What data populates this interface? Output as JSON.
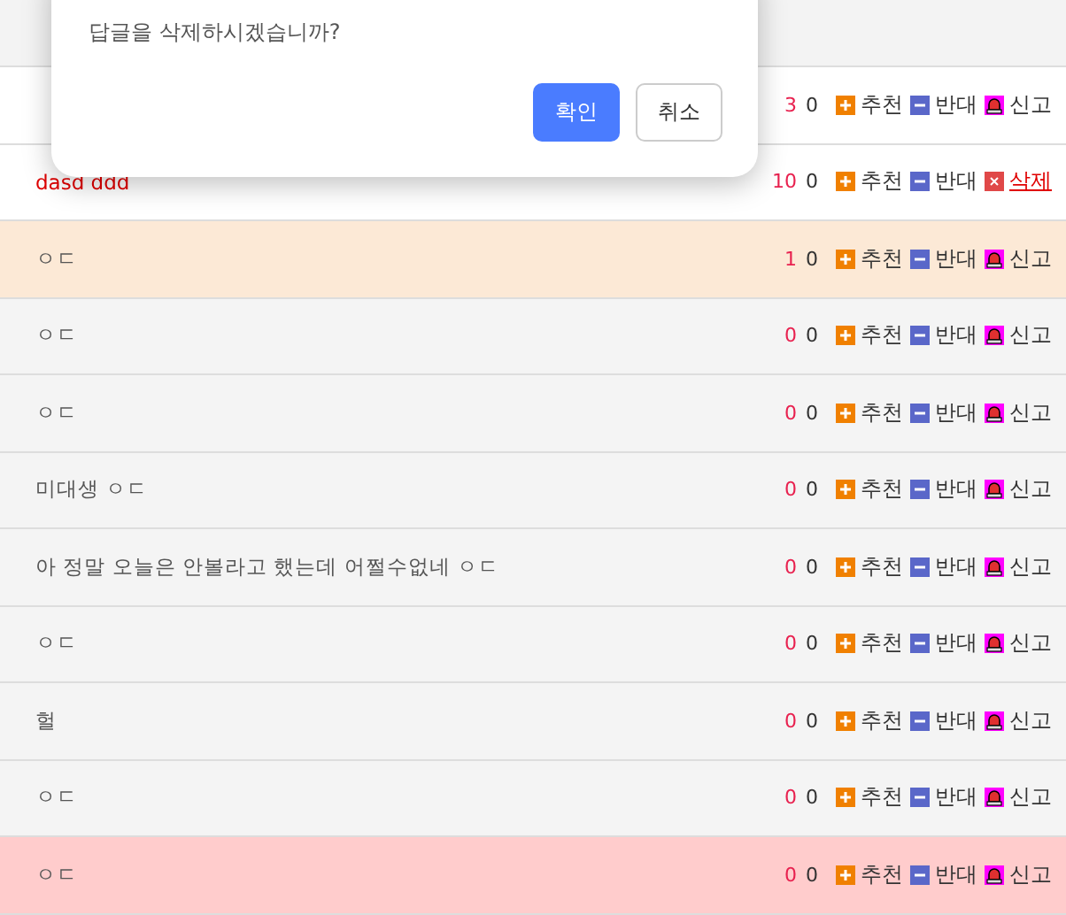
{
  "rows": [
    {
      "color": "#ffffff",
      "up": "3",
      "down": "0",
      "actions": [
        {
          "kind": "up",
          "label": "추천"
        },
        {
          "kind": "down",
          "label": "반대"
        },
        {
          "kind": "report",
          "label": "신고"
        }
      ]
    },
    {
      "text": "dasd ddd",
      "highlighted": true,
      "color": "#ffffff",
      "up": "10",
      "down": "0",
      "actions": [
        {
          "kind": "up",
          "label": "추천"
        },
        {
          "kind": "down",
          "label": "반대"
        },
        {
          "kind": "delete",
          "label": "삭제"
        }
      ]
    },
    {
      "text": "ㅇㄷ",
      "highlighted": false,
      "color": "#fce9d6",
      "up": "1",
      "down": "0",
      "actions": [
        {
          "kind": "up",
          "label": "추천"
        },
        {
          "kind": "down",
          "label": "반대"
        },
        {
          "kind": "report",
          "label": "신고"
        }
      ]
    },
    {
      "text": "ㅇㄷ",
      "highlighted": false,
      "color": "#f4f4f4",
      "up": "0",
      "down": "0",
      "actions": [
        {
          "kind": "up",
          "label": "추천"
        },
        {
          "kind": "down",
          "label": "반대"
        },
        {
          "kind": "report",
          "label": "신고"
        }
      ]
    },
    {
      "text": "ㅇㄷ",
      "highlighted": false,
      "color": "#f4f4f4",
      "up": "0",
      "down": "0",
      "actions": [
        {
          "kind": "up",
          "label": "추천"
        },
        {
          "kind": "down",
          "label": "반대"
        },
        {
          "kind": "report",
          "label": "신고"
        }
      ]
    },
    {
      "text": "미대생 ㅇㄷ",
      "highlighted": false,
      "color": "#f4f4f4",
      "up": "0",
      "down": "0",
      "actions": [
        {
          "kind": "up",
          "label": "추천"
        },
        {
          "kind": "down",
          "label": "반대"
        },
        {
          "kind": "report",
          "label": "신고"
        }
      ]
    },
    {
      "text": "아 정말 오늘은 안볼라고 했는데 어쩔수없네 ㅇㄷ",
      "highlighted": false,
      "color": "#f4f4f4",
      "up": "0",
      "down": "0",
      "actions": [
        {
          "kind": "up",
          "label": "추천"
        },
        {
          "kind": "down",
          "label": "반대"
        },
        {
          "kind": "report",
          "label": "신고"
        }
      ]
    },
    {
      "text": "ㅇㄷ",
      "highlighted": false,
      "color": "#f4f4f4",
      "up": "0",
      "down": "0",
      "actions": [
        {
          "kind": "up",
          "label": "추천"
        },
        {
          "kind": "down",
          "label": "반대"
        },
        {
          "kind": "report",
          "label": "신고"
        }
      ]
    },
    {
      "text": "헐",
      "highlighted": false,
      "color": "#f4f4f4",
      "up": "0",
      "down": "0",
      "actions": [
        {
          "kind": "up",
          "label": "추천"
        },
        {
          "kind": "down",
          "label": "반대"
        },
        {
          "kind": "report",
          "label": "신고"
        }
      ]
    },
    {
      "text": "ㅇㄷ",
      "highlighted": false,
      "color": "#f4f4f4",
      "up": "0",
      "down": "0",
      "actions": [
        {
          "kind": "up",
          "label": "추천"
        },
        {
          "kind": "down",
          "label": "반대"
        },
        {
          "kind": "report",
          "label": "신고"
        }
      ]
    },
    {
      "text": "ㅇㄷ",
      "highlighted": false,
      "color": "#ffcccc",
      "up": "0",
      "down": "0",
      "actions": [
        {
          "kind": "up",
          "label": "추천"
        },
        {
          "kind": "down",
          "label": "반대"
        },
        {
          "kind": "report",
          "label": "신고"
        }
      ]
    }
  ],
  "dialog": {
    "message": "답글을 삭제하시겠습니까?",
    "buttons": [
      {
        "kind": "primary",
        "label": "확인"
      },
      {
        "kind": "secondary",
        "label": "취소"
      }
    ]
  }
}
